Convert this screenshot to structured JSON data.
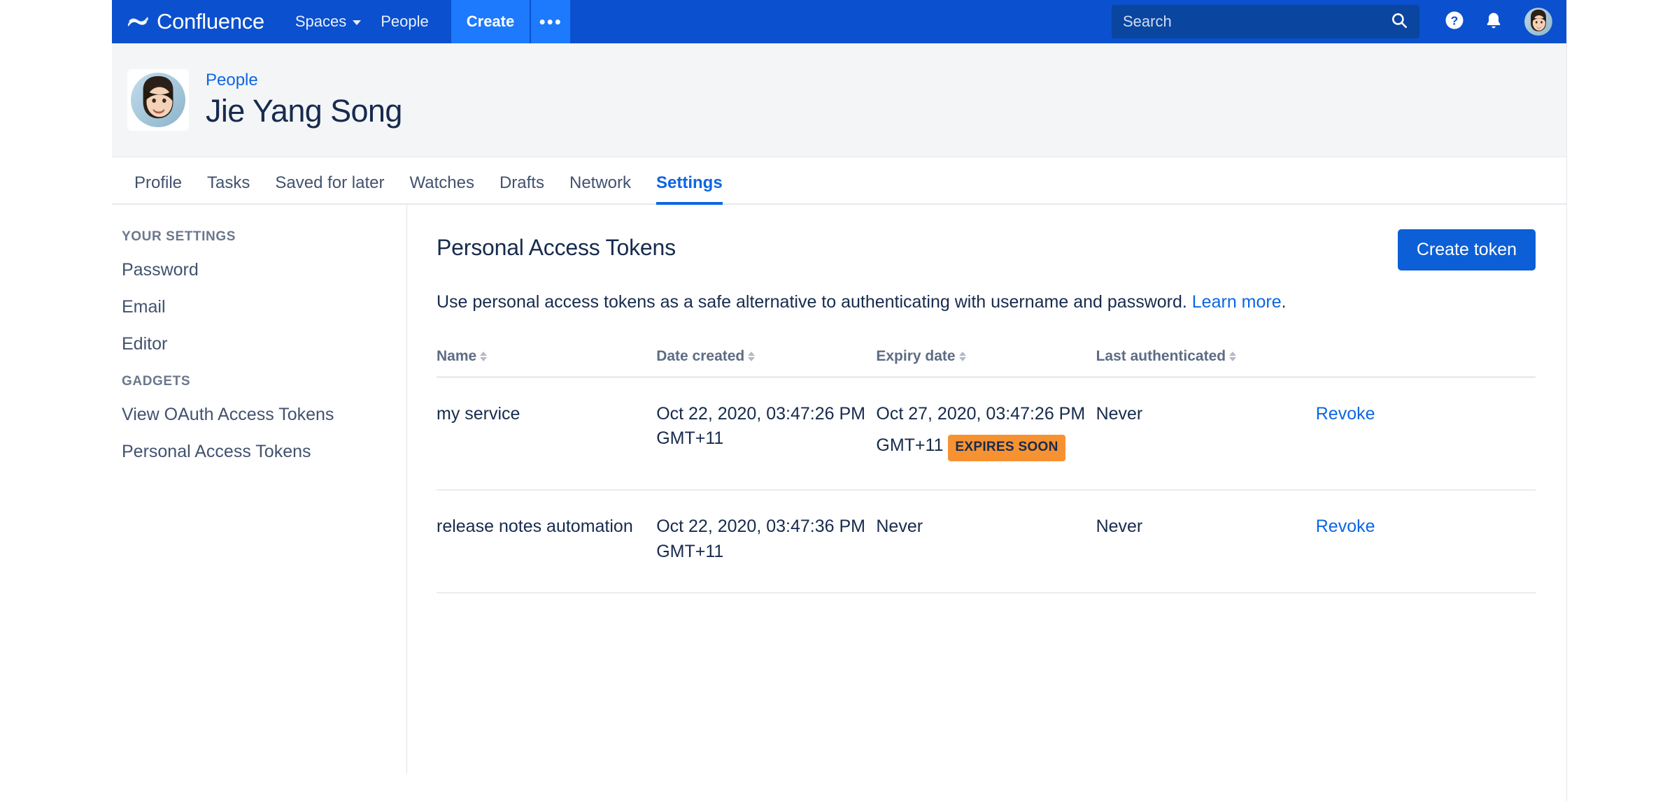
{
  "topnav": {
    "logo_text": "Confluence",
    "logo_icon": "confluence-logo-icon",
    "items": [
      {
        "label": "Spaces",
        "has_chevron": true
      },
      {
        "label": "People",
        "has_chevron": false
      }
    ],
    "create_label": "Create",
    "more_label": "•••",
    "search_placeholder": "Search",
    "search_value": "",
    "search_icon": "search-icon",
    "help_icon": "help-icon",
    "notifications_icon": "notification-bell-icon",
    "avatar_icon": "user-avatar",
    "bg_color": "#0b50ce",
    "create_color": "#1d7afc"
  },
  "profile": {
    "breadcrumb": "People",
    "name": "Jie Yang Song",
    "avatar_icon": "profile-avatar"
  },
  "tabs": [
    {
      "label": "Profile",
      "active": false
    },
    {
      "label": "Tasks",
      "active": false
    },
    {
      "label": "Saved for later",
      "active": false
    },
    {
      "label": "Watches",
      "active": false
    },
    {
      "label": "Drafts",
      "active": false
    },
    {
      "label": "Network",
      "active": false
    },
    {
      "label": "Settings",
      "active": true
    }
  ],
  "sidebar": {
    "section_your_settings": "YOUR SETTINGS",
    "items_your_settings": [
      {
        "label": "Password"
      },
      {
        "label": "Email"
      },
      {
        "label": "Editor"
      }
    ],
    "section_gadgets": "GADGETS",
    "items_gadgets": [
      {
        "label": "View OAuth Access Tokens"
      },
      {
        "label": "Personal Access Tokens"
      }
    ]
  },
  "main": {
    "title": "Personal Access Tokens",
    "create_token_label": "Create token",
    "intro_text": "Use personal access tokens as a safe alternative to authenticating with username and password. ",
    "intro_link": "Learn more",
    "intro_suffix": ".",
    "accent_color": "#0c66e4",
    "table": {
      "columns": [
        {
          "label": "Name",
          "sortable": true
        },
        {
          "label": "Date created",
          "sortable": true
        },
        {
          "label": "Expiry date",
          "sortable": true
        },
        {
          "label": "Last authenticated",
          "sortable": true
        },
        {
          "label": "",
          "sortable": false
        }
      ],
      "rows": [
        {
          "name": "my service",
          "date_created": "Oct 22, 2020, 03:47:26 PM GMT+11",
          "expiry_date": "Oct 27, 2020, 03:47:26 PM GMT+11",
          "expiry_badge": "EXPIRES SOON",
          "badge_color": "#f79232",
          "last_authenticated": "Never",
          "action": "Revoke"
        },
        {
          "name": "release notes automation",
          "date_created": "Oct 22, 2020, 03:47:36 PM GMT+11",
          "expiry_date": "Never",
          "expiry_badge": "",
          "badge_color": "",
          "last_authenticated": "Never",
          "action": "Revoke"
        }
      ]
    }
  }
}
